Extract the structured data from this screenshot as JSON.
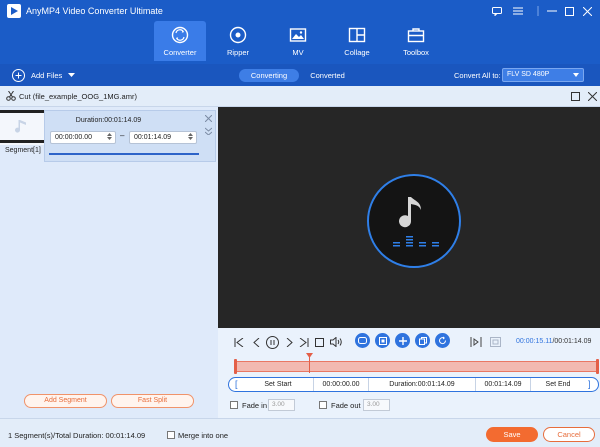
{
  "app": {
    "title": "AnyMP4 Video Converter Ultimate"
  },
  "nav": {
    "tabs": [
      {
        "label": "Converter",
        "icon": "converter-icon",
        "active": true
      },
      {
        "label": "Ripper",
        "icon": "disc-icon"
      },
      {
        "label": "MV",
        "icon": "image-icon"
      },
      {
        "label": "Collage",
        "icon": "collage-icon"
      },
      {
        "label": "Toolbox",
        "icon": "toolbox-icon"
      }
    ]
  },
  "toolbar": {
    "add_files": "Add Files",
    "segments": [
      "Converting",
      "Converted"
    ],
    "convert_all_label": "Convert All to:",
    "format_selected": "FLV SD 480P"
  },
  "cut": {
    "title": "Cut (file_example_OOG_1MG.amr)",
    "segment": {
      "label": "Segment[1]",
      "duration": "Duration:00:01:14.09",
      "start": "00:00:00.00",
      "dash": "–",
      "end": "00:01:14.09"
    },
    "add_segment": "Add Segment",
    "fast_split": "Fast Split"
  },
  "player": {
    "current_time": "00:00:15.11",
    "total_time": "/00:01:14.09",
    "playhead_fraction": 0.205
  },
  "range": {
    "set_start": "Set Start",
    "start_time": "00:00:00.00",
    "duration": "Duration:00:01:14.09",
    "end_time": "00:01:14.09",
    "set_end": "Set End",
    "bracket_left": "[",
    "bracket_right": "]"
  },
  "fade": {
    "fade_in_label": "Fade in",
    "fade_in_value": "3.00",
    "fade_out_label": "Fade out",
    "fade_out_value": "3.00"
  },
  "footer": {
    "summary": "1 Segment(s)/Total Duration: 00:01:14.09",
    "merge_label": "Merge into one",
    "save": "Save",
    "cancel": "Cancel"
  },
  "colors": {
    "header_blue": "#1b5cc7",
    "active_tab": "#3a7ce8",
    "accent_blue": "#2f73de",
    "timeline_fill": "#f2b9b1",
    "timeline_marker": "#e35f48",
    "save_orange": "#f36b30"
  }
}
